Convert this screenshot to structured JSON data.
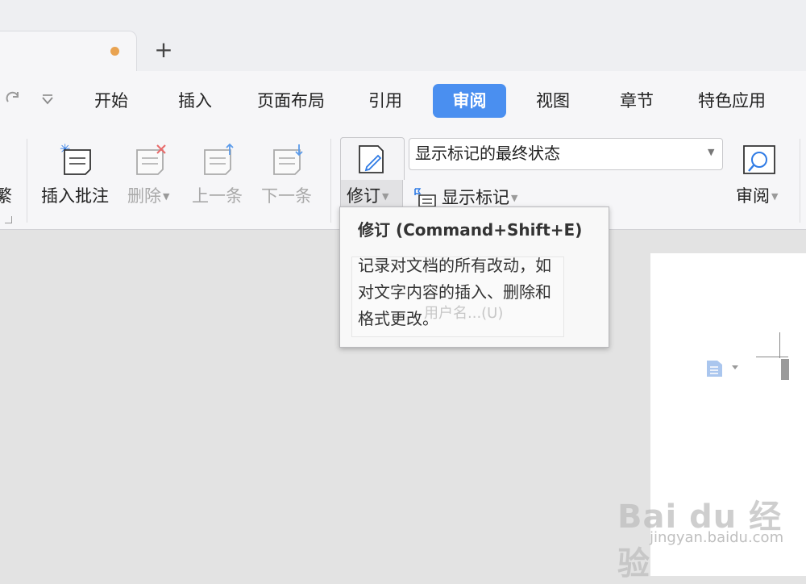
{
  "tabs": {
    "new_tab_label": "+",
    "modified_dot_color": "#e9a351"
  },
  "menu": {
    "items": [
      {
        "label": "开始"
      },
      {
        "label": "插入"
      },
      {
        "label": "页面布局"
      },
      {
        "label": "引用"
      },
      {
        "label": "审阅",
        "active": true
      },
      {
        "label": "视图"
      },
      {
        "label": "章节"
      },
      {
        "label": "特色应用"
      }
    ],
    "active_color": "#4a8ff0"
  },
  "ribbon": {
    "cut_group_label": "繁",
    "comment_buttons": [
      {
        "label": "插入批注",
        "enabled": true,
        "icon": "insert-comment-icon"
      },
      {
        "label": "删除",
        "enabled": false,
        "icon": "delete-comment-icon"
      },
      {
        "label": "上一条",
        "enabled": false,
        "icon": "previous-comment-icon"
      },
      {
        "label": "下一条",
        "enabled": false,
        "icon": "next-comment-icon"
      }
    ],
    "revise_label": "修订",
    "display_mode_value": "显示标记的最终状态",
    "show_markup_label": "显示标记",
    "review_label": "审阅"
  },
  "tooltip": {
    "title": "修订 (Command+Shift+E)",
    "lines": [
      "记录对文档的所有改动，如",
      "对文字内容的插入、删除和",
      "格式更改。"
    ]
  },
  "ghost_menu": {
    "user_name_item": "用户名...(U)"
  },
  "watermark": {
    "logo_text": "Bai du 经验",
    "url": "jingyan.baidu.com"
  }
}
